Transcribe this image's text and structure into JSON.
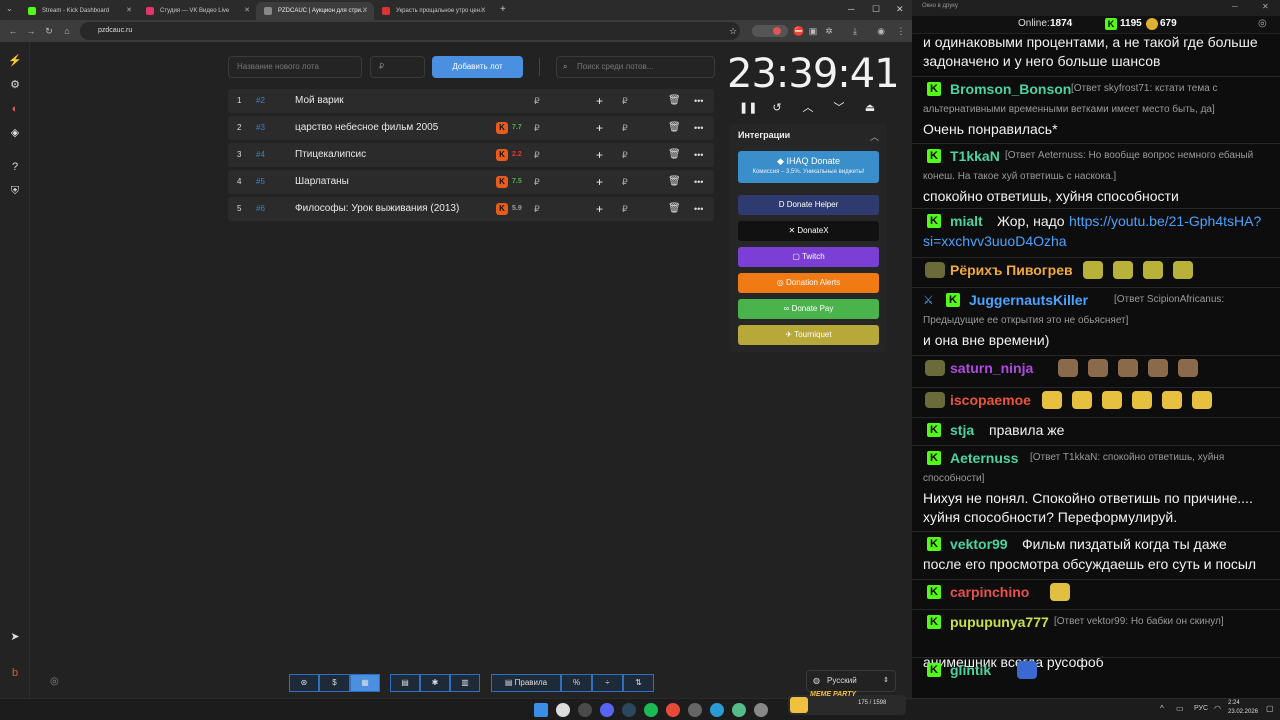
{
  "tabs": [
    {
      "label": "Stream - Kick Dashboard",
      "fav_color": "#53fc18"
    },
    {
      "label": "Студия — VK Видео Live",
      "fav_color": "#e6336b"
    },
    {
      "label": "PZDCAUC | Аукцион для стри...",
      "fav_color": "#888"
    },
    {
      "label": "Украсть прощальное утро цен...",
      "fav_color": "#d33"
    }
  ],
  "url": "pzdcauc.ru",
  "lot_input_placeholder": "Название нового лота",
  "price_placeholder": "₽",
  "add_lot_label": "Добавить лот",
  "search_placeholder": "Поиск среди лотов...",
  "lots": [
    {
      "num": "1",
      "id": "#2",
      "name": "Мой варик",
      "rating": "",
      "rating_color": "",
      "rub": "₽"
    },
    {
      "num": "2",
      "id": "#3",
      "name": "царство небесное фильм 2005",
      "rating": "7.7",
      "rating_color": "#4caf50",
      "rub": "₽"
    },
    {
      "num": "3",
      "id": "#4",
      "name": "Птицекалипсис",
      "rating": "2.2",
      "rating_color": "#e53935",
      "rub": "₽"
    },
    {
      "num": "4",
      "id": "#5",
      "name": "Шарлатаны",
      "rating": "7.5",
      "rating_color": "#4caf50",
      "rub": "₽"
    },
    {
      "num": "5",
      "id": "#6",
      "name": "Философы: Урок выживания (2013)",
      "rating": "5.9",
      "rating_color": "#9e9e9e",
      "rub": "₽"
    }
  ],
  "timer": "23:39:41",
  "integrations_title": "Интеграции",
  "integrations": [
    {
      "label": "IHAQ Donate",
      "sub": "Комиссия – 3,5%. Уникальные виджеты!",
      "color": "#3a8ec9"
    },
    {
      "label": "Donate Helper",
      "color": "#2f3a6e"
    },
    {
      "label": "DonateX",
      "color": "#111111"
    },
    {
      "label": "Twitch",
      "color": "#7b3fd6"
    },
    {
      "label": "Donation Alerts",
      "color": "#f07b15"
    },
    {
      "label": "Donate Pay",
      "color": "#4bb34b"
    },
    {
      "label": "Tourniquet",
      "color": "#b7a83a"
    }
  ],
  "bottom_buttons": [
    "Правила"
  ],
  "language": "Русский",
  "chat": {
    "window_title": "Окно в друку",
    "online_label": "Online:",
    "online_count": "1874",
    "kick_count": "1195",
    "other_count": "679",
    "lines_top": [
      "и одинаковыми процентами, а не такой где больше",
      "задоначено и у него больше шансов"
    ],
    "messages": [
      {
        "user": "Bromson_Bonson",
        "color": "#4bd3a0",
        "reply": "[Ответ skyfrost71: кстати тема с",
        "reply2": "альтернативными временными ветками имеет место быть, да]",
        "text": "Очень понравилась*"
      },
      {
        "user": "T1kkaN",
        "color": "#4bd3a0",
        "reply": "[Ответ Aeternuss: Но вообще вопрос немного ебаный",
        "reply2": "конеш. На такое хуй ответишь с наскока.]",
        "text": "спокойно ответишь, хуйня способности"
      },
      {
        "user": "mialt",
        "color": "#4bd3a0",
        "text": "Жор, надо",
        "link": "https://youtu.be/21-Gph4tsHA?",
        "link2": "si=xxchvv3uuoD4Ozha"
      },
      {
        "user": "Рёрихъ Пивогрев",
        "color": "#f0a93a"
      },
      {
        "user": "JuggernautsKiller",
        "color": "#4aa3ff",
        "reply": "[Ответ ScipionAfricanus:",
        "reply2": "Предыдущие ее открытия это не обьясняет]",
        "text": "и она вне времени)"
      },
      {
        "user": "saturn_ninja",
        "color": "#b04ae0"
      },
      {
        "user": "iscopaemoe",
        "color": "#e8553b"
      },
      {
        "user": "stja",
        "color": "#4bd3a0",
        "text": "правила же"
      },
      {
        "user": "Aeternuss",
        "color": "#4bd3a0",
        "reply": "[Ответ T1kkaN: спокойно ответишь, хуйня",
        "reply2": "способности]",
        "text": "Нихуя не понял. Спокойно ответишь по причине....",
        "text2": "хуйня способности? Переформулируй."
      },
      {
        "user": "vektor99",
        "color": "#4bd3a0",
        "text": "Фильм пиздатый когда ты даже",
        "text2": "после его просмотра обсуждаешь его суть и посыл"
      },
      {
        "user": "carpinchino",
        "color": "#e85050"
      },
      {
        "user": "pupupunya777",
        "color": "#c8e04a",
        "reply": "[Ответ vektor99: Но бабки он скинул]",
        "text": "анимешник всегда русофоб"
      },
      {
        "user": "glintik",
        "color": "#4bd3a0"
      }
    ]
  },
  "tray": {
    "time": "2:24",
    "date": "23.02.2026",
    "lang": "РУС",
    "meme_label": "MEME PARTY",
    "counter": "175 / 1598"
  }
}
